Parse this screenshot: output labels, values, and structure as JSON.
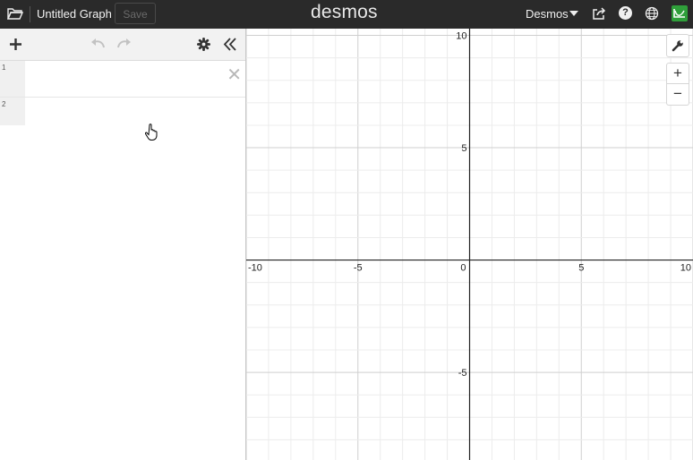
{
  "header": {
    "title": "Untitled Graph",
    "save_label": "Save",
    "logo": "desmos",
    "user_menu": "Desmos",
    "help_glyph": "?"
  },
  "icons": {
    "folder": "folder-open-icon",
    "share": "share-icon",
    "help": "help-icon",
    "language": "globe-icon",
    "brand": "desmos-user-icon",
    "add": "plus-icon",
    "undo": "undo-icon",
    "redo": "redo-icon",
    "settings": "gear-icon",
    "collapse": "double-chevron-left-icon",
    "wrench": "wrench-icon",
    "zoom_in": "zoom-in-icon",
    "zoom_out": "zoom-out-icon"
  },
  "expressions": [
    {
      "index": "1",
      "value": ""
    },
    {
      "index": "2",
      "value": ""
    }
  ],
  "graph": {
    "x_ticks": [
      "-10",
      "-5",
      "0",
      "5",
      "10"
    ],
    "y_ticks": [
      "10",
      "5",
      "-5"
    ],
    "x_range": [
      -10,
      10
    ],
    "y_range": [
      -8.9,
      10.3
    ]
  },
  "controls": {
    "zoom_in_label": "+",
    "zoom_out_label": "−"
  },
  "colors": {
    "topbar": "#2a2a2a",
    "grid_minor": "#ececec",
    "grid_major": "#cfcfcf",
    "axis": "#222222",
    "brand_green": "#2f9f3a"
  }
}
